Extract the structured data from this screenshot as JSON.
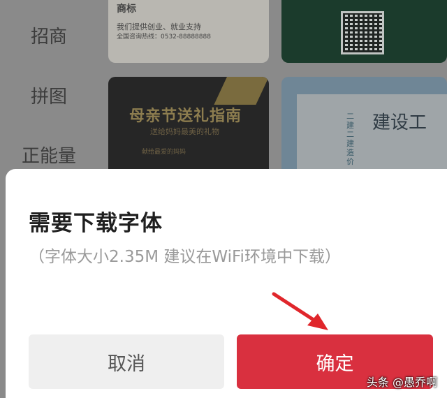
{
  "background": {
    "categories": [
      {
        "label": "招商"
      },
      {
        "label": "拼图"
      },
      {
        "label": "正能量"
      }
    ],
    "card_a": {
      "logo": "商标",
      "line1": "我们提供创业、就业支持",
      "line2": "全国咨询热线：0532-88888888"
    },
    "card_c": {
      "title": "母亲节送礼指南",
      "subtitle": "送给妈妈最美的礼物",
      "tag": "献给最爱的妈妈"
    },
    "card_d": {
      "big_text": "建设工",
      "vertical_text": "二建二建造价"
    }
  },
  "dialog": {
    "title": "需要下载字体",
    "subtitle": "（字体大小2.35M 建议在WiFi环境中下载）",
    "cancel_label": "取消",
    "confirm_label": "确定"
  },
  "watermark": "头条 @愚乔啊",
  "colors": {
    "confirm": "#d9303f",
    "cancel_bg": "#efefef",
    "arrow": "#e0262b"
  }
}
